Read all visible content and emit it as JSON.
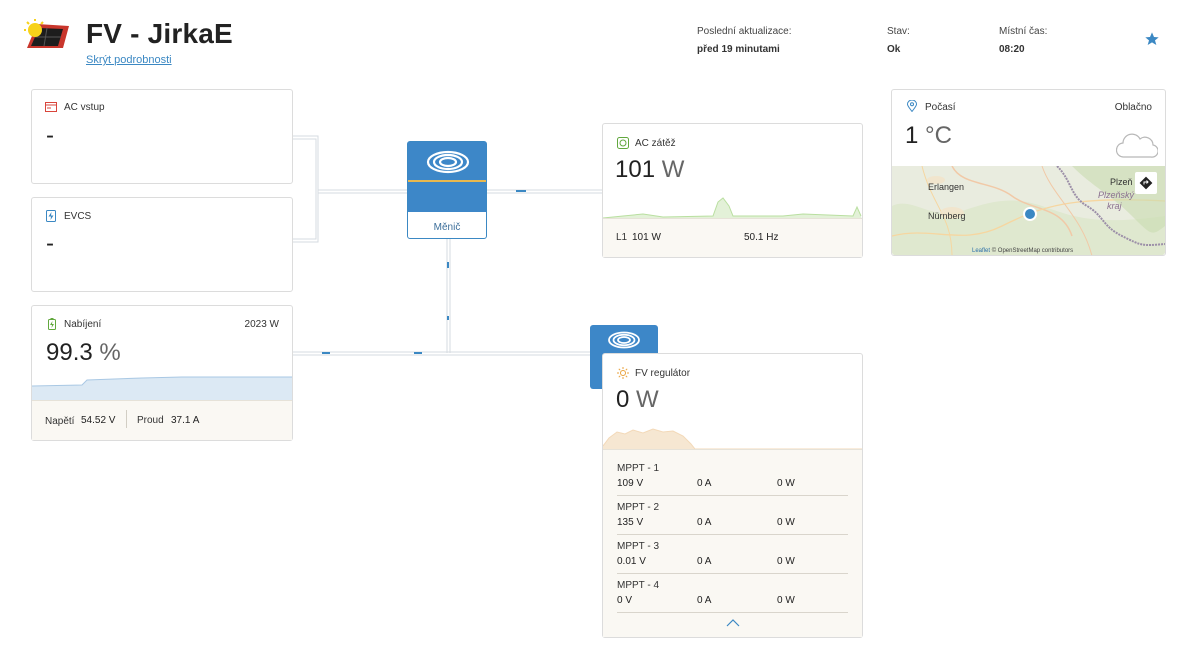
{
  "header": {
    "title": "FV - JirkaE",
    "hide_details": "Skrýt podrobnosti",
    "last_update_label": "Poslední aktualizace:",
    "last_update_value": "před 19 minutami",
    "status_label": "Stav:",
    "status_value": "Ok",
    "local_time_label": "Místní čas:",
    "local_time_value": "08:20"
  },
  "ac_input": {
    "title": "AC vstup",
    "value": "-"
  },
  "evcs": {
    "title": "EVCS",
    "value": "-"
  },
  "battery": {
    "title": "Nabíjení",
    "power": "2023 W",
    "soc_number": "99.3",
    "soc_unit": "%",
    "voltage_label": "Napětí",
    "voltage_value": "54.52 V",
    "current_label": "Proud",
    "current_value": "37.1 A"
  },
  "inverter": {
    "label": "Měnič"
  },
  "ac_load": {
    "title": "AC zátěž",
    "power_number": "101",
    "power_unit": "W",
    "phase_label": "L1",
    "phase_power": "101 W",
    "frequency": "50.1 Hz"
  },
  "pv": {
    "title": "FV regulátor",
    "power_number": "0",
    "power_unit": "W",
    "trackers": [
      {
        "name": "MPPT - 1",
        "voltage": "109 V",
        "current": "0 A",
        "power": "0 W"
      },
      {
        "name": "MPPT - 2",
        "voltage": "135 V",
        "current": "0 A",
        "power": "0 W"
      },
      {
        "name": "MPPT - 3",
        "voltage": "0.01 V",
        "current": "0 A",
        "power": "0 W"
      },
      {
        "name": "MPPT - 4",
        "voltage": "0 V",
        "current": "0 A",
        "power": "0 W"
      }
    ]
  },
  "weather": {
    "title": "Počasí",
    "condition": "Oblačno",
    "temp_number": "1",
    "temp_unit": "°C",
    "map": {
      "city_erlangen": "Erlangen",
      "city_nurnberg": "Nürnberg",
      "city_plzen": "Plzeň",
      "region_plzensky": "Plzeňský",
      "region_kraj": "kraj",
      "attribution_leaflet": "Leaflet",
      "attribution_osm": "© OpenStreetMap contributors"
    }
  },
  "colors": {
    "accent": "#3d87c8",
    "sparkline_green": "#b9dfa0",
    "sparkline_blue": "#b7d3ea",
    "sparkline_orange": "#f3d9b8",
    "footer_bg": "#faf8f3"
  },
  "icons": {
    "logo": "solar-panel-logo",
    "star": "star-icon",
    "ac_input": "ac-input-icon",
    "evcs": "ev-charger-icon",
    "battery": "battery-icon",
    "ac_load": "plug-icon",
    "pv": "sun-icon",
    "weather": "location-pin-icon",
    "cloud": "cloud-icon",
    "collapse": "chevron-up-icon"
  }
}
